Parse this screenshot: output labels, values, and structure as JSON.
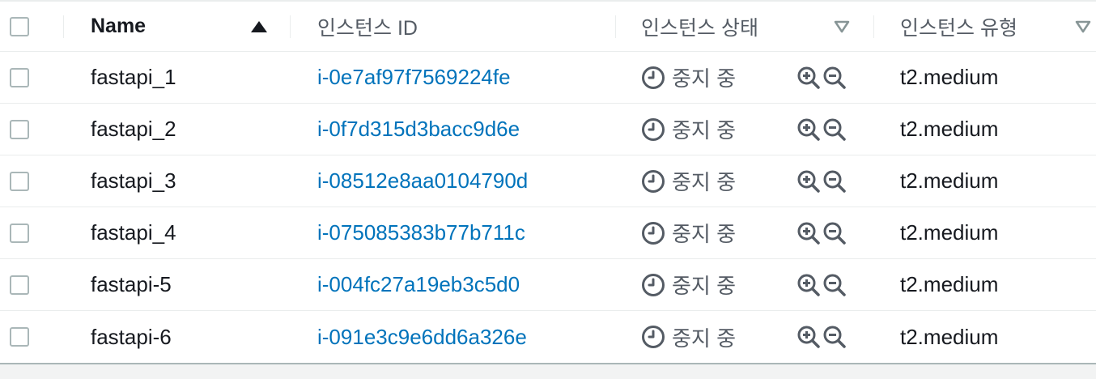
{
  "table": {
    "columns": {
      "name": "Name",
      "instance_id": "인스턴스 ID",
      "instance_state": "인스턴스 상태",
      "instance_type": "인스턴스 유형"
    },
    "rows": [
      {
        "name": "fastapi_1",
        "instance_id": "i-0e7af97f7569224fe",
        "state": "중지 중",
        "type": "t2.medium"
      },
      {
        "name": "fastapi_2",
        "instance_id": "i-0f7d315d3bacc9d6e",
        "state": "중지 중",
        "type": "t2.medium"
      },
      {
        "name": "fastapi_3",
        "instance_id": "i-08512e8aa0104790d",
        "state": "중지 중",
        "type": "t2.medium"
      },
      {
        "name": "fastapi_4",
        "instance_id": "i-075085383b77b711c",
        "state": "중지 중",
        "type": "t2.medium"
      },
      {
        "name": "fastapi-5",
        "instance_id": "i-004fc27a19eb3c5d0",
        "state": "중지 중",
        "type": "t2.medium"
      },
      {
        "name": "fastapi-6",
        "instance_id": "i-091e3c9e6dd6a326e",
        "state": "중지 중",
        "type": "t2.medium"
      }
    ]
  },
  "icons": {
    "sort": "sort-ascending-icon",
    "filter": "filter-triangle-icon",
    "status": "stopping-clock-icon",
    "zoom_in": "zoom-in-icon",
    "zoom_out": "zoom-out-icon"
  },
  "colors": {
    "link": "#0073bb",
    "status_text": "#545b64",
    "border": "#eaeded"
  }
}
